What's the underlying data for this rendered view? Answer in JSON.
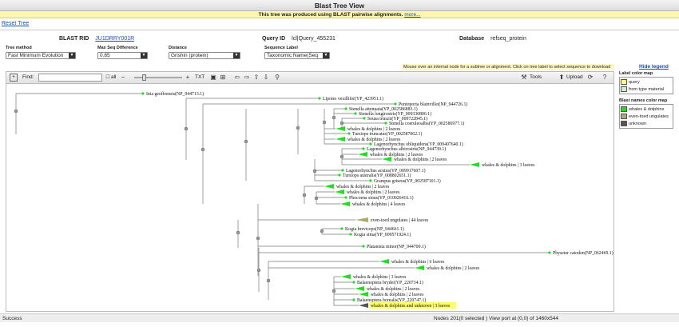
{
  "window_title": "Blast Tree View",
  "notice": {
    "text": "This tree was produced using BLAST pairwise alignments.",
    "link": "more..."
  },
  "reset_label": "Reset Tree",
  "info": {
    "rid_label": "BLAST RID",
    "rid_value": "JU1DRRY001R",
    "query_label": "Query ID",
    "query_value": "lcl|Query_455231",
    "db_label": "Database",
    "db_value": "refseq_protein"
  },
  "controls": {
    "tree_method": {
      "label": "Tree method",
      "value": "Fast Minimum Evolution"
    },
    "max_seq_diff": {
      "label": "Max Seq Difference",
      "value": "0.85"
    },
    "distance": {
      "label": "Distance",
      "value": "Grishin (protein)"
    },
    "seq_label": {
      "label": "Sequence Label",
      "value": "Taxonomic Name(Seq"
    }
  },
  "mouseover_hint": "Mouse over an internal node for a subtree or alignment. Click on tree label to select sequence to download",
  "hide_legend": "Hide legend",
  "toolbar": {
    "find_label": "Find:",
    "all_label": "all",
    "txt_label": "TXT",
    "tools_label": "Tools",
    "upload_label": "Upload"
  },
  "legend": {
    "label_color_title": "Label color map",
    "label_items": [
      {
        "label": "query",
        "color": "#ffff80"
      },
      {
        "label": "from type material",
        "color": "#c8f0c8"
      }
    ],
    "blast_color_title": "Blast names color map",
    "blast_items": [
      {
        "label": "whales & dolphins",
        "color": "#22dd22"
      },
      {
        "label": "even-toed ungulates",
        "color": "#b0a870"
      },
      {
        "label": "unknown",
        "color": "#555555"
      }
    ]
  },
  "colors": {
    "whales": "#22dd22",
    "ungulates": "#b0a870",
    "unknown": "#555555",
    "query_highlight": "#ffff66"
  },
  "tree": {
    "labels": [
      "Inia geoffrensis(NP_944713.1)",
      "Lipotes vexillifer(YP_423951.1)",
      "Pontoporia blainvillei(NP_944726.1)",
      "Stenella attenuata(YP_002586883.1)",
      "Stenella longirostris(YP_009330806.1)",
      "Sousa teuszii(YP_009722845.1)",
      "Stenella coeruleoalba(YP_002586977.1)",
      "whales & dolphins | 2 leaves",
      "Tursiops truncatus(YP_002587062.1)",
      "whales & dolphins | 2 leaves",
      "Lagenorhynchus obliquidens(YP_009407640.1)",
      "Lagenorhynchus albirostris(NP_944739.1)",
      "whales & dolphins | 2 leaves",
      "whales & dolphins | 2 leaves",
      "whales & dolphins | 3 leaves",
      "Lagenorhynchus acutus(YP_009917607.1)",
      "Tursiops australis(YP_008802651.1)",
      "Grampus griseus(YP_002587101.1)",
      "whales & dolphins | 2 leaves",
      "whales & dolphins | 2 leaves",
      "Phocoena sinus(YP_010026416.1)",
      "whales & dolphins | 4 leaves",
      "even-toed ungulates | 44 leaves",
      "Kogia breviceps(NP_944661.1)",
      "Kogia sima(YP_009571924.1)",
      "Platanista minor(NP_944700.1)",
      "Physeter catodon(NP_062469.1)",
      "whales & dolphins | 6 leaves",
      "whales & dolphins | 2 leaves",
      "whales & dolphins | 3 leaves",
      "Balaenoptera brydei(YP_220734.1)",
      "whales & dolphins | 2 leaves",
      "whales & dolphins | 2 leaves",
      "Balaenoptera borealis(YP_220747.1)",
      "whales & dolphins and unknown | 3 leaves"
    ]
  },
  "status": {
    "left": "Success",
    "nodes": "Nodes 201(0 selected )",
    "viewport": "View port at (0,0)  of 1460x544"
  }
}
